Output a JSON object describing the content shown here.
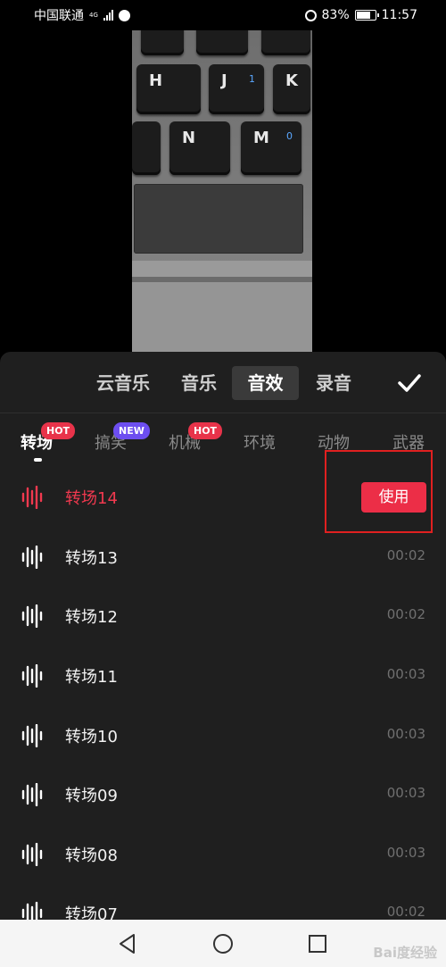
{
  "status_bar": {
    "carrier": "中国联通",
    "network": "4G",
    "battery": "83%",
    "battery_level": 0.83,
    "time": "11:57"
  },
  "preview": {
    "keys": {
      "h": "H",
      "j": "J",
      "j_sub": "1",
      "k": "K",
      "n": "N",
      "m": "M",
      "m_sub": "0"
    }
  },
  "main_tabs": [
    {
      "label": "云音乐",
      "active": false
    },
    {
      "label": "音乐",
      "active": false
    },
    {
      "label": "音效",
      "active": true
    },
    {
      "label": "录音",
      "active": false
    }
  ],
  "categories": [
    {
      "label": "转场",
      "active": true,
      "badge": "HOT"
    },
    {
      "label": "搞笑",
      "active": false,
      "badge": "NEW"
    },
    {
      "label": "机械",
      "active": false,
      "badge": "HOT"
    },
    {
      "label": "环境",
      "active": false,
      "badge": ""
    },
    {
      "label": "动物",
      "active": false,
      "badge": ""
    },
    {
      "label": "武器",
      "active": false,
      "badge": ""
    }
  ],
  "sounds": [
    {
      "name": "转场14",
      "duration": "",
      "playing": true,
      "action": "使用"
    },
    {
      "name": "转场13",
      "duration": "00:02",
      "playing": false
    },
    {
      "name": "转场12",
      "duration": "00:02",
      "playing": false
    },
    {
      "name": "转场11",
      "duration": "00:03",
      "playing": false
    },
    {
      "name": "转场10",
      "duration": "00:03",
      "playing": false
    },
    {
      "name": "转场09",
      "duration": "00:03",
      "playing": false
    },
    {
      "name": "转场08",
      "duration": "00:03",
      "playing": false
    },
    {
      "name": "转场07",
      "duration": "00:02",
      "playing": false
    }
  ],
  "watermark": "Bai度经验",
  "colors": {
    "accent": "#ec2e47",
    "panel_bg": "#1f1f1f",
    "hot_badge": "#e8334a",
    "new_badge": "#6d4ef0"
  }
}
